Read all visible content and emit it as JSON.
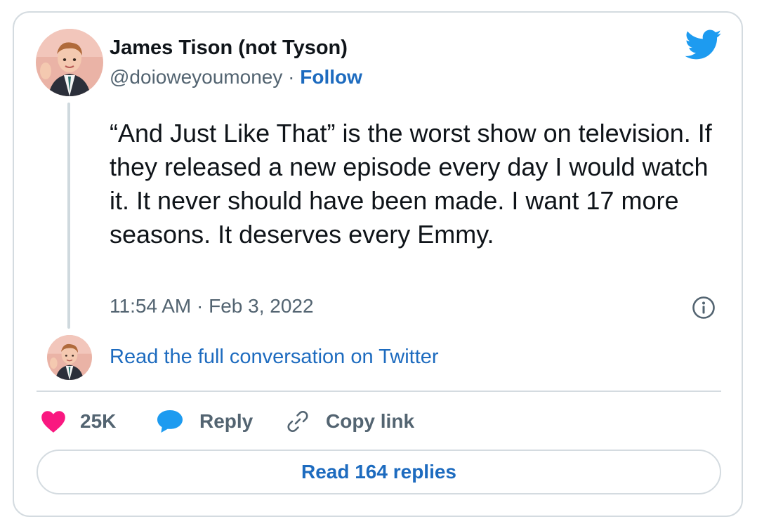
{
  "tweet": {
    "author_name": "James Tison (not Tyson)",
    "handle": "@doioweyoumoney",
    "separator": " · ",
    "follow_label": "Follow",
    "text": "“And Just Like That” is the worst show on television. If they released a new episode every day I would watch it. It never should have been made. I want 17 more seasons. It deserves every Emmy.",
    "timestamp": "11:54 AM · Feb 3, 2022",
    "read_conversation_label": "Read the full conversation on Twitter"
  },
  "actions": {
    "likes_count": "25K",
    "reply_label": "Reply",
    "copy_link_label": "Copy link"
  },
  "read_replies_label": "Read 164 replies",
  "icons": {
    "brand": "twitter-bird-icon",
    "info": "info-icon",
    "like": "heart-icon",
    "reply": "speech-bubble-icon",
    "copy": "link-icon"
  },
  "colors": {
    "link_blue": "#1d6bbf",
    "twitter_blue": "#1d9bf0",
    "like_pink": "#f91880",
    "muted_text": "#536471",
    "border": "#d4dbe0"
  }
}
